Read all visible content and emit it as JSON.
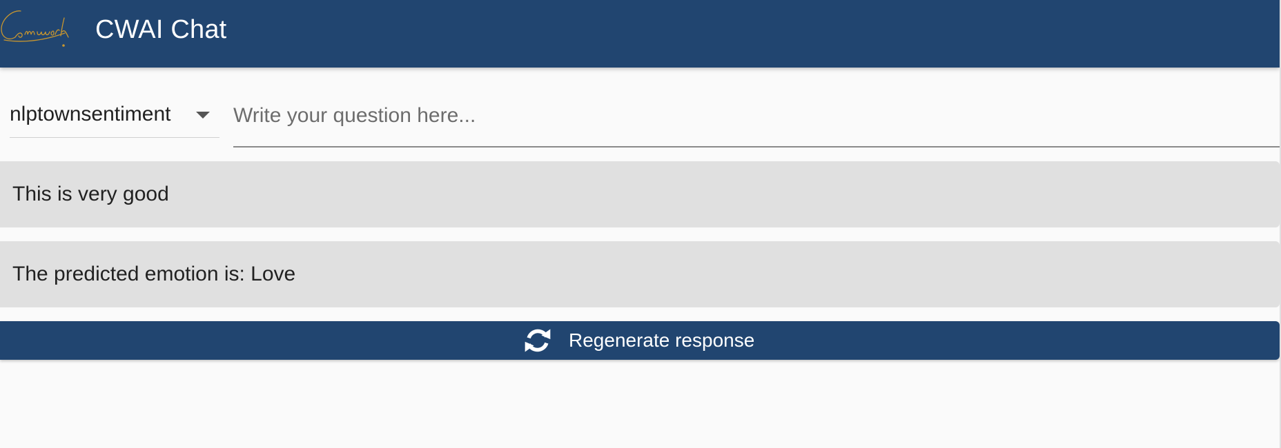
{
  "header": {
    "title": "CWAI Chat",
    "logo_text": "Comwork",
    "logo_icon": "comwork-signature-logo"
  },
  "input_row": {
    "model_value": "nlptownsentiment",
    "question_value": "",
    "question_placeholder": "Write your question here..."
  },
  "messages": [
    {
      "role": "user",
      "text": "This is very good"
    },
    {
      "role": "assistant",
      "text": "The predicted emotion is: Love"
    }
  ],
  "actions": {
    "regenerate_label": "Regenerate response",
    "regenerate_icon": "refresh-icon"
  },
  "colors": {
    "header_bg": "#214570",
    "button_bg": "#214570",
    "message_bg": "#e0e0e0",
    "logo_gold": "#c8962f"
  }
}
